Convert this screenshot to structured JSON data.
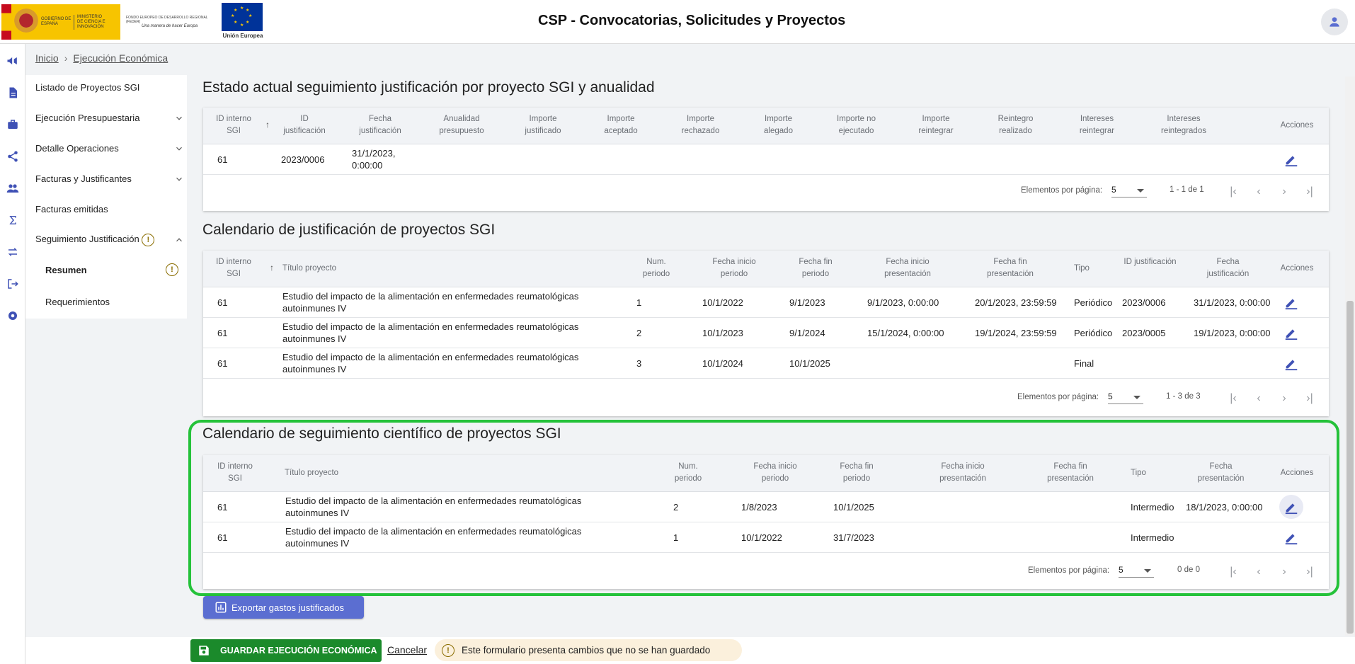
{
  "header": {
    "app_title": "CSP - Convocatorias, Solicitudes y Proyectos",
    "logo_gob_line1": "GOBIERNO DE ESPAÑA",
    "logo_gob_line2": "MINISTERIO DE CIENCIA E INNOVACIÓN",
    "logo_feder_line1": "FONDO EUROPEO DE DESARROLLO REGIONAL (FEDER)",
    "logo_feder_line2": "Una manera de hacer Europa",
    "logo_eu_label": "Unión Europea"
  },
  "breadcrumb": {
    "home": "Inicio",
    "current": "Ejecución Económica"
  },
  "sidebar": {
    "items": [
      {
        "label": "Listado de Proyectos SGI",
        "expandable": false
      },
      {
        "label": "Ejecución Presupuestaria",
        "expandable": true
      },
      {
        "label": "Detalle Operaciones",
        "expandable": true
      },
      {
        "label": "Facturas y Justificantes",
        "expandable": true
      },
      {
        "label": "Facturas emitidas",
        "expandable": false
      },
      {
        "label": "Seguimiento Justificación",
        "expandable": true,
        "expanded": true,
        "warning": true
      }
    ],
    "subitems": [
      {
        "label": "Resumen",
        "selected": true,
        "warning": true
      },
      {
        "label": "Requerimientos",
        "selected": false
      }
    ]
  },
  "warning_glyph": "!",
  "sections": {
    "estado": {
      "title": "Estado actual seguimiento justificación por proyecto SGI y anualidad",
      "headers": [
        "ID interno SGI",
        "ID justificación",
        "Fecha justificación",
        "Anualidad presupuesto",
        "Importe justificado",
        "Importe aceptado",
        "Importe rechazado",
        "Importe alegado",
        "Importe no ejecutado",
        "Importe reintegrar",
        "Reintegro realizado",
        "Intereses reintegrar",
        "Intereses reintegrados",
        "Acciones"
      ],
      "rows": [
        [
          "61",
          "2023/0006",
          "31/1/2023, 0:00:00",
          "",
          "",
          "",
          "",
          "",
          "",
          "",
          "",
          "",
          ""
        ]
      ],
      "pager": {
        "label": "Elementos por página:",
        "page_size": "5",
        "range": "1 - 1 de 1"
      }
    },
    "calendario_justificacion": {
      "title": "Calendario de justificación de proyectos SGI",
      "headers": [
        "ID interno SGI",
        "Título proyecto",
        "Num. periodo",
        "Fecha inicio periodo",
        "Fecha fin periodo",
        "Fecha inicio presentación",
        "Fecha fin presentación",
        "Tipo",
        "ID justificación",
        "Fecha justificación",
        "Acciones"
      ],
      "rows": [
        [
          "61",
          "Estudio del impacto de la alimentación en enfermedades reumatológicas autoinmunes IV",
          "1",
          "10/1/2022",
          "9/1/2023",
          "9/1/2023, 0:00:00",
          "20/1/2023, 23:59:59",
          "Periódico",
          "2023/0006",
          "31/1/2023, 0:00:00"
        ],
        [
          "61",
          "Estudio del impacto de la alimentación en enfermedades reumatológicas autoinmunes IV",
          "2",
          "10/1/2023",
          "9/1/2024",
          "15/1/2024, 0:00:00",
          "19/1/2024, 23:59:59",
          "Periódico",
          "2023/0005",
          "19/1/2023, 0:00:00"
        ],
        [
          "61",
          "Estudio del impacto de la alimentación en enfermedades reumatológicas autoinmunes IV",
          "3",
          "10/1/2024",
          "10/1/2025",
          "",
          "",
          "Final",
          "",
          ""
        ]
      ],
      "pager": {
        "label": "Elementos por página:",
        "page_size": "5",
        "range": "1 - 3 de 3"
      }
    },
    "calendario_cientifico": {
      "title": "Calendario de seguimiento científico de proyectos SGI",
      "headers": [
        "ID interno SGI",
        "Título proyecto",
        "Num. periodo",
        "Fecha inicio periodo",
        "Fecha fin periodo",
        "Fecha inicio presentación",
        "Fecha fin presentación",
        "Tipo",
        "Fecha presentación",
        "Acciones"
      ],
      "rows": [
        [
          "61",
          "Estudio del impacto de la alimentación en enfermedades reumatológicas autoinmunes IV",
          "2",
          "1/8/2023",
          "10/1/2025",
          "",
          "",
          "Intermedio",
          "18/1/2023, 0:00:00"
        ],
        [
          "61",
          "Estudio del impacto de la alimentación en enfermedades reumatológicas autoinmunes IV",
          "1",
          "10/1/2022",
          "31/7/2023",
          "",
          "",
          "Intermedio",
          ""
        ]
      ],
      "pager": {
        "label": "Elementos por página:",
        "page_size": "5",
        "range": "0 de 0"
      }
    }
  },
  "export_button": "Exportar gastos justificados",
  "footer": {
    "save_label": "GUARDAR EJECUCIÓN ECONÓMICA",
    "cancel_label": "Cancelar",
    "unsaved_message": "Este formulario presenta cambios que no se han guardado"
  },
  "colors": {
    "primary": "#5b6ed1",
    "save_green": "#1b8a2b",
    "highlight_green": "#25c23a",
    "edit_icon": "#3f51b5",
    "warning_bg": "#fbf0dc"
  },
  "icons": {
    "rail": [
      "megaphone-icon",
      "document-icon",
      "briefcase-icon",
      "share-icon",
      "people-icon",
      "sigma-icon",
      "transfer-icon",
      "logout-icon",
      "gear-icon"
    ],
    "user": "account-icon",
    "edit": "pencil-icon",
    "sort": "arrow-up-icon"
  }
}
